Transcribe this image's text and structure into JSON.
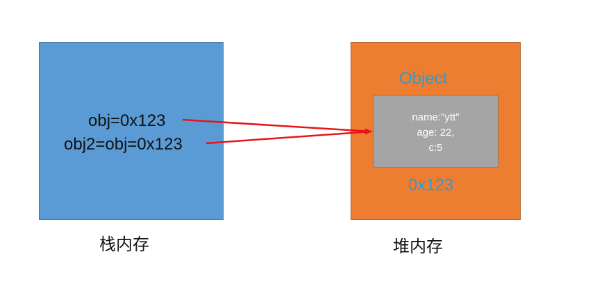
{
  "colors": {
    "stack_fill": "#5b9bd5",
    "heap_fill": "#ed7d31",
    "object_fill": "#a5a5a5",
    "heap_text": "#2e9bd6",
    "arrow": "#e81416"
  },
  "stack": {
    "lines": [
      "obj=0x123",
      "obj2=obj=0x123"
    ],
    "caption": "栈内存"
  },
  "heap": {
    "title": "Object",
    "object_fields": [
      "name:\"ytt\"",
      "age: 22,",
      "c:5"
    ],
    "address": "0x123",
    "caption": "堆内存"
  },
  "arrows": [
    {
      "from": "stack.lines.0",
      "to": "heap.object"
    },
    {
      "from": "stack.lines.1",
      "to": "heap.object"
    }
  ]
}
